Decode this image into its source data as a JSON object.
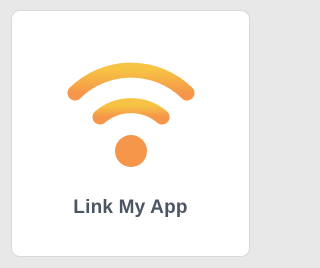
{
  "card": {
    "label": "Link My App",
    "icon": "wifi-icon"
  },
  "colors": {
    "background": "#e8e8e9",
    "card": "#ffffff",
    "label": "#4c5564",
    "icon_top": "#f7c344",
    "icon_bottom": "#f5964a"
  }
}
